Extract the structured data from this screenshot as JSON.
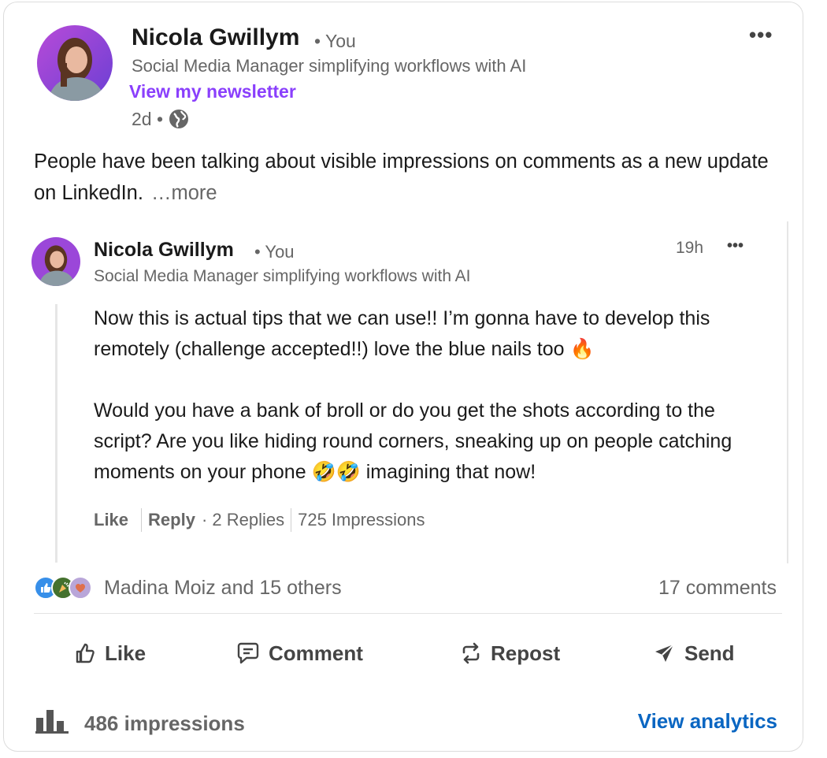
{
  "post": {
    "author_name": "Nicola Gwillym",
    "author_badge": "• You",
    "author_headline": "Social Media Manager simplifying workflows with AI",
    "newsletter_link": "View my newsletter",
    "age": "2d •",
    "visibility_icon": "globe-icon",
    "more_icon": "more-horizontal-icon",
    "text": "People have been talking about visible impressions on comments as a new update on LinkedIn.",
    "see_more": "…more"
  },
  "comment": {
    "author_name": "Nicola Gwillym",
    "author_badge": "• You",
    "author_headline": "Social Media Manager simplifying workflows with AI",
    "time": "19h",
    "paragraphs": [
      "Now this is actual tips that we can use!! I’m gonna have to develop this remotely (challenge accepted!!) love the blue nails too 🔥",
      "Would you have a bank of broll or do you get the shots according to the script? Are you like hiding round corners, sneaking up on people catching moments on your phone 🤣🤣 imagining that now!"
    ],
    "like_label": "Like",
    "reply_label": "Reply",
    "replies_label": "· 2 Replies",
    "impressions_label": "725 Impressions"
  },
  "social": {
    "reactors": "Madina Moiz and 15 others",
    "comments": "17 comments",
    "reaction_icons": [
      "like-reaction-icon",
      "celebrate-reaction-icon",
      "love-reaction-icon"
    ]
  },
  "actions": {
    "like": "Like",
    "comment": "Comment",
    "repost": "Repost",
    "send": "Send"
  },
  "footer": {
    "impressions": "486 impressions",
    "analytics_link": "View analytics"
  },
  "colors": {
    "newsletter": "#8a3ffc",
    "analytics": "#0a66c2",
    "muted": "#666666"
  }
}
